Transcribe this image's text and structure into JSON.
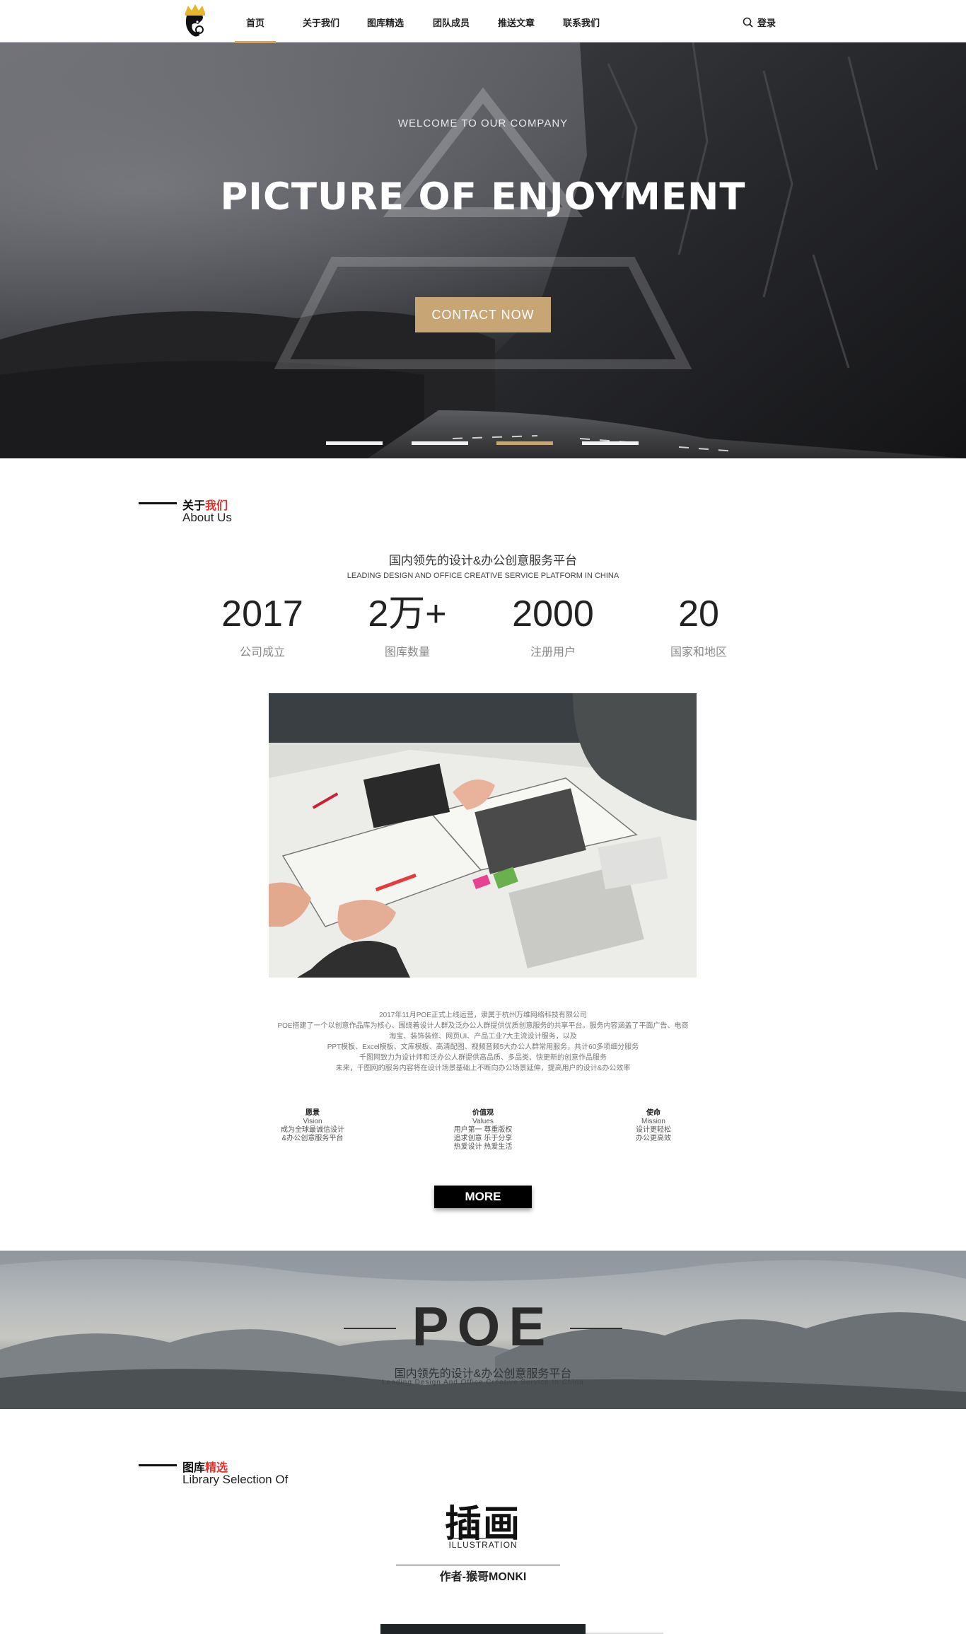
{
  "nav": {
    "items": [
      "首页",
      "关于我们",
      "图库精选",
      "团队成员",
      "推送文章",
      "联系我们"
    ],
    "login": "登录",
    "accent": "#c7a571"
  },
  "hero": {
    "welcome": "WELCOME TO OUR COMPANY",
    "title": "PICTURE OF ENJOYMENT",
    "button": "CONTACT NOW",
    "slides": 4,
    "active_slide": 3
  },
  "about": {
    "heading_cn_a": "关于",
    "heading_cn_b": "我们",
    "heading_en": "About Us",
    "tagline_cn": "国内领先的设计&办公创意服务平台",
    "tagline_en": "LEADING DESIGN AND OFFICE CREATIVE SERVICE PLATFORM IN CHINA",
    "stats": [
      {
        "num": "2017",
        "label": "公司成立"
      },
      {
        "num": "2万+",
        "label": "图库数量"
      },
      {
        "num": "2000",
        "label": "注册用户"
      },
      {
        "num": "20",
        "label": "国家和地区"
      }
    ],
    "paragraph": [
      "2017年11月POE正式上线运营，隶属于杭州万维网络科技有限公司",
      "POE搭建了一个以创意作品库为核心、围绕着设计人群及泛办公人群提供优质创意服务的共享平台。服务内容涵盖了平面广告、电商",
      "淘宝、装饰装修、网页UI、产品工业7大主流设计服务，以及",
      "PPT模板、Excel模板、文库模板、高清配图、视频音频5大办公人群常用服务，共计60多项细分服务",
      "千图网致力为设计师和泛办公人群提供高品质、多品类、快更新的创意作品服务",
      "未来，千图网的服务内容将在设计场景基础上不断向办公场景延伸，提高用户的设计&办公效率"
    ],
    "columns": [
      {
        "title": "愿景",
        "en": "Vision",
        "lines": [
          "成为全球最诚信设计",
          "&办公创意服务平台"
        ]
      },
      {
        "title": "价值观",
        "en": "Values",
        "lines": [
          "用户第一 尊重版权",
          "追求创意 乐于分享",
          "热爱设计 热爱生活"
        ]
      },
      {
        "title": "使命",
        "en": "Mission",
        "lines": [
          "设计更轻松",
          "办公更高效"
        ]
      }
    ],
    "more": "MORE"
  },
  "poe": {
    "title": "POE",
    "cn": "国内领先的设计&办公创意服务平台",
    "en": "Leading Design And Office Creative Service In China"
  },
  "gallery": {
    "heading_cn_a": "图库",
    "heading_cn_b": "精选",
    "heading_en": "Library Selection Of",
    "category_cn": "插画",
    "category_en": "ILLUSTRATION",
    "author": "作者-猴哥MONKI"
  }
}
